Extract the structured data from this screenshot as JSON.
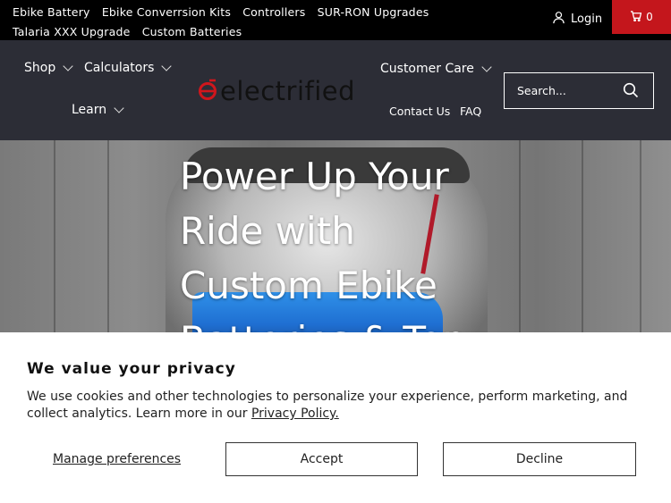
{
  "topbar": {
    "links": [
      "Ebike Battery",
      "Ebike Converrsion Kits",
      "Controllers",
      "SUR-RON Upgrades",
      "Talaria XXX Upgrade",
      "Custom Batteries"
    ],
    "login_label": "Login",
    "cart_count": "0"
  },
  "header": {
    "nav": {
      "shop": "Shop",
      "calculators": "Calculators",
      "learn": "Learn",
      "customer_care": "Customer Care",
      "contact_us": "Contact Us",
      "faq": "FAQ"
    },
    "logo_text": "electrified",
    "search": {
      "placeholder": "Search..."
    }
  },
  "hero": {
    "title": "Power Up Your Ride with Custom Ebike Batteries & Top"
  },
  "cookie": {
    "heading": "We value your privacy",
    "body": "We use cookies and other technologies to personalize your experience, perform marketing, and collect analytics. Learn more in our",
    "policy_link": "Privacy Policy.",
    "manage_label": "Manage preferences",
    "accept_label": "Accept",
    "decline_label": "Decline"
  },
  "colors": {
    "topbar_bg": "#000000",
    "header_bg": "#2c2d36",
    "cart_red": "#c4161c",
    "logo_red": "#d0161c"
  },
  "icons": {
    "login": "user-icon",
    "cart": "cart-icon",
    "search": "search-icon",
    "logo": "bike-logo-icon",
    "dropdown": "chevron-down-icon"
  }
}
